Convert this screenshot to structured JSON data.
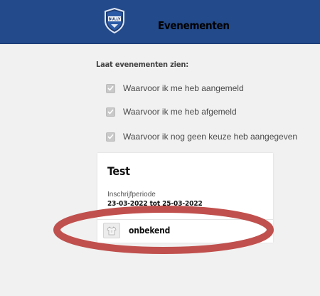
{
  "header": {
    "title": "Evenementen",
    "logo_text": "BULLY",
    "background_color": "#234a8a"
  },
  "filters": {
    "heading": "Laat evenementen zien:",
    "options": [
      {
        "label": "Waarvoor ik me heb aangemeld",
        "checked": true
      },
      {
        "label": "Waarvoor ik me heb afgemeld",
        "checked": true
      },
      {
        "label": "Waarvoor ik nog geen keuze heb aangegeven",
        "checked": true
      }
    ]
  },
  "event_card": {
    "title": "Test",
    "period_label": "Inschrijfperiode",
    "period_value": "23-03-2022 tot 25-03-2022",
    "status_icon": "shirt-icon",
    "status_label": "onbekend"
  },
  "annotation": {
    "shape": "ellipse",
    "color": "#c0504d"
  }
}
